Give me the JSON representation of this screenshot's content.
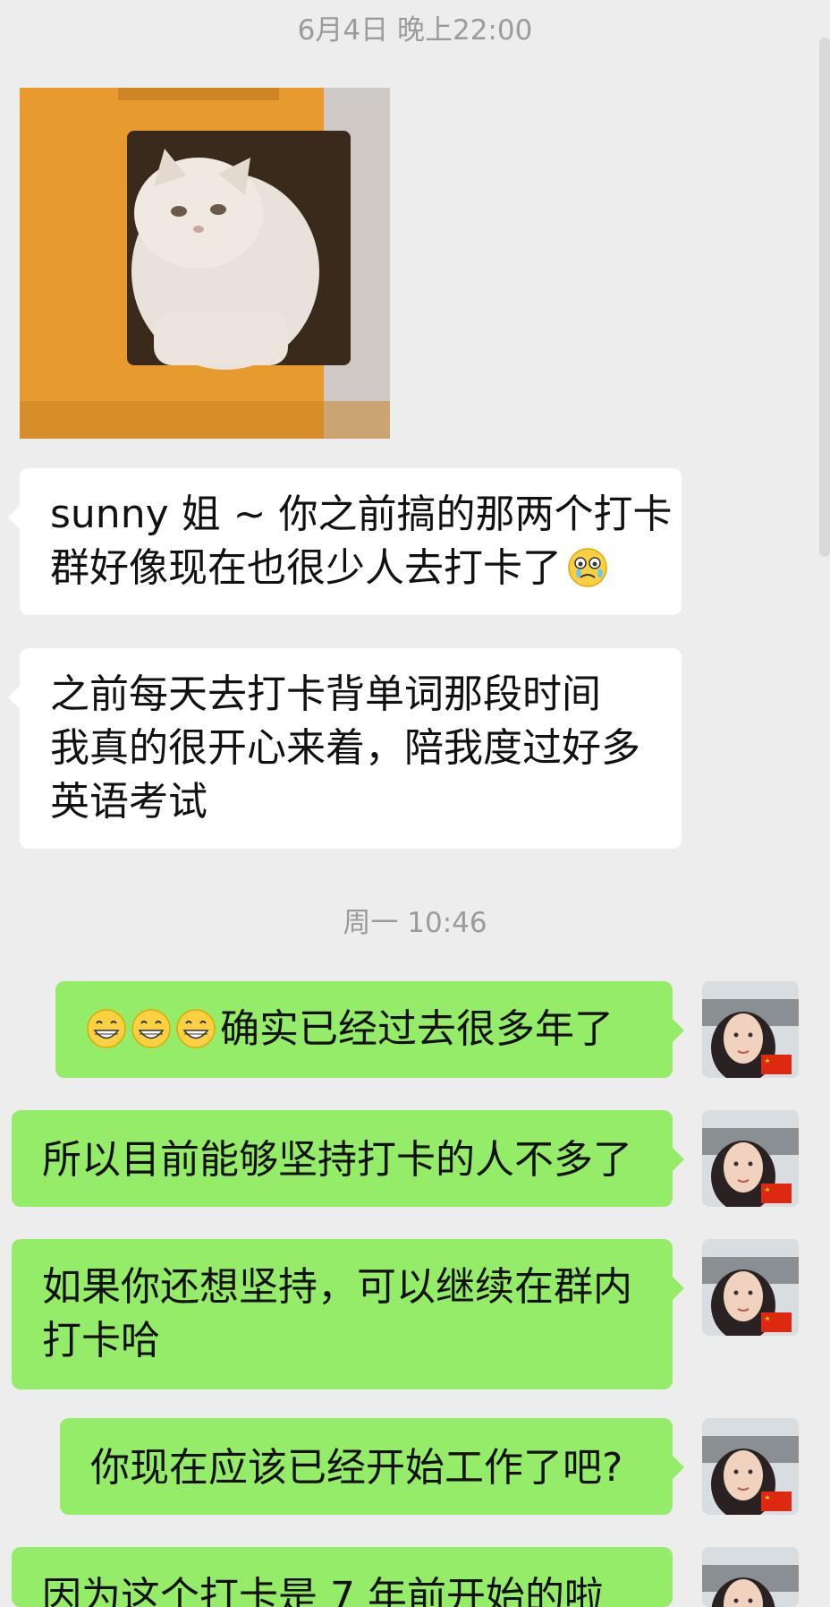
{
  "timestamps": [
    "6月4日 晚上22:00",
    "周一 10:46"
  ],
  "colors": {
    "background": "#ededed",
    "received_bubble": "#ffffff",
    "sent_bubble": "#95ec69",
    "timestamp_text": "#9b9b9b"
  },
  "received": [
    {
      "type": "sticker",
      "icon": "cat-in-box-sticker"
    },
    {
      "type": "text",
      "lines": [
        "sunny 姐 ~ 你之前搞的那两个打卡",
        "群好像现在也很少人去打卡了"
      ],
      "emoji_after": "crying-face-emoji"
    },
    {
      "type": "text",
      "lines": [
        "之前每天去打卡背单词那段时间",
        "我真的很开心来着，陪我度过好多",
        "英语考试"
      ]
    }
  ],
  "sent": [
    {
      "emoji_before": [
        "grinning-face-emoji",
        "grinning-face-emoji",
        "grinning-face-emoji"
      ],
      "lines": [
        "确实已经过去很多年了"
      ]
    },
    {
      "lines": [
        "所以目前能够坚持打卡的人不多了"
      ]
    },
    {
      "lines": [
        "如果你还想坚持，可以继续在群内",
        "打卡哈"
      ]
    },
    {
      "lines": [
        "你现在应该已经开始工作了吧?"
      ]
    },
    {
      "lines": [
        "因为这个打卡是 7 年前开始的啦"
      ]
    }
  ]
}
